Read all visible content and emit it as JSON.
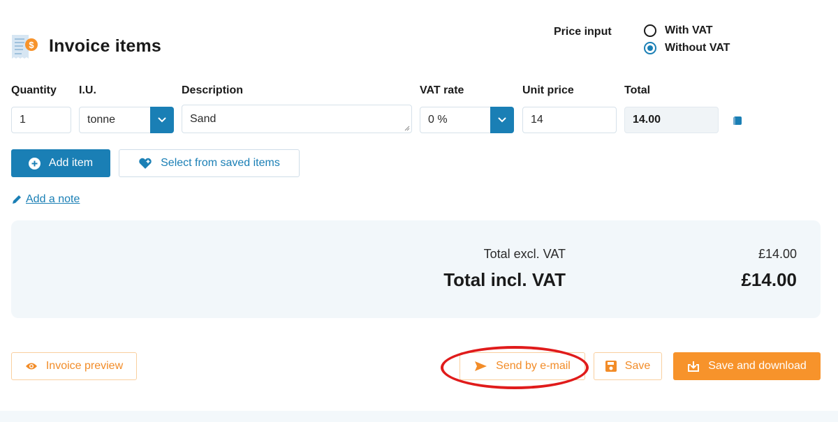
{
  "header": {
    "title": "Invoice items",
    "icon": "receipt-dollar-icon"
  },
  "price_input": {
    "label": "Price input",
    "options": [
      {
        "label": "With VAT",
        "selected": false
      },
      {
        "label": "Without VAT",
        "selected": true
      }
    ]
  },
  "columns": {
    "quantity": "Quantity",
    "unit": "I.U.",
    "description": "Description",
    "vat_rate": "VAT rate",
    "unit_price": "Unit price",
    "total": "Total"
  },
  "items": [
    {
      "quantity": "1",
      "unit": "tonne",
      "description": "Sand",
      "vat_rate": "0 %",
      "unit_price": "14",
      "total": "14.00"
    }
  ],
  "actions": {
    "add_item": "Add item",
    "select_saved": "Select from saved items",
    "add_note": "Add a note"
  },
  "totals": {
    "excl_label": "Total excl. VAT",
    "excl_value": "£14.00",
    "incl_label": "Total incl. VAT",
    "incl_value": "£14.00"
  },
  "footer": {
    "preview": "Invoice preview",
    "send_email": "Send by e-mail",
    "save": "Save",
    "save_download": "Save and download"
  },
  "colors": {
    "primary_blue": "#1a7fb5",
    "accent_orange": "#f7932b",
    "annotation_red": "#e01b1b",
    "totals_bg": "#f2f7fa"
  }
}
